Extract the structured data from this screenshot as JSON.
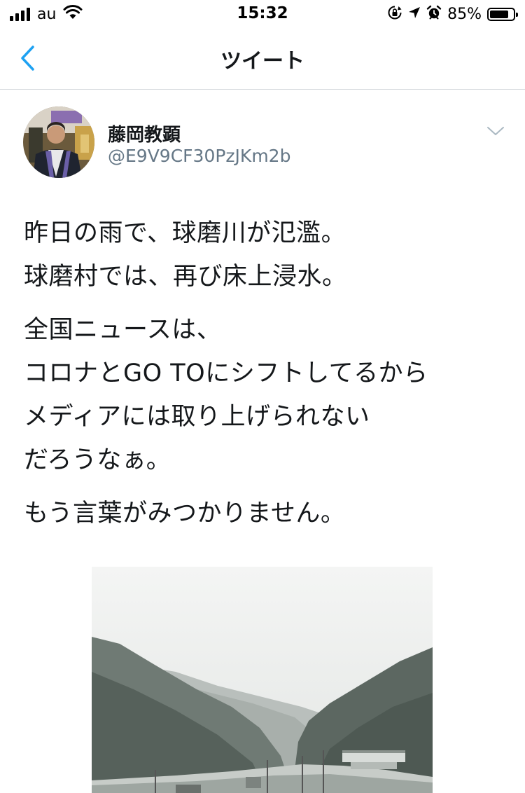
{
  "status_bar": {
    "carrier": "au",
    "time": "15:32",
    "battery_percent": "85%",
    "battery_level": 0.85,
    "icons": [
      "signal-icon",
      "wifi-icon",
      "orientation-lock-icon",
      "location-icon",
      "alarm-icon",
      "battery-icon"
    ]
  },
  "nav": {
    "back_icon": "chevron-left-icon",
    "title": "ツイート"
  },
  "tweet": {
    "author": {
      "display_name": "藤岡教顕",
      "handle": "@E9V9CF30PzJKm2b"
    },
    "menu_icon": "chevron-down-icon",
    "paragraphs": [
      [
        "昨日の雨で、球磨川が氾濫。",
        "球磨村では、再び床上浸水。"
      ],
      [
        "全国ニュースは、",
        "コロナとGO TOにシフトしてるから",
        "メディアには取り上げられない",
        "だろうなぁ。"
      ],
      [
        "もう言葉がみつかりません。"
      ]
    ]
  },
  "colors": {
    "accent": "#1da1f2",
    "text": "#14171a",
    "secondary_text": "#657786",
    "divider": "#d4d8dc"
  }
}
